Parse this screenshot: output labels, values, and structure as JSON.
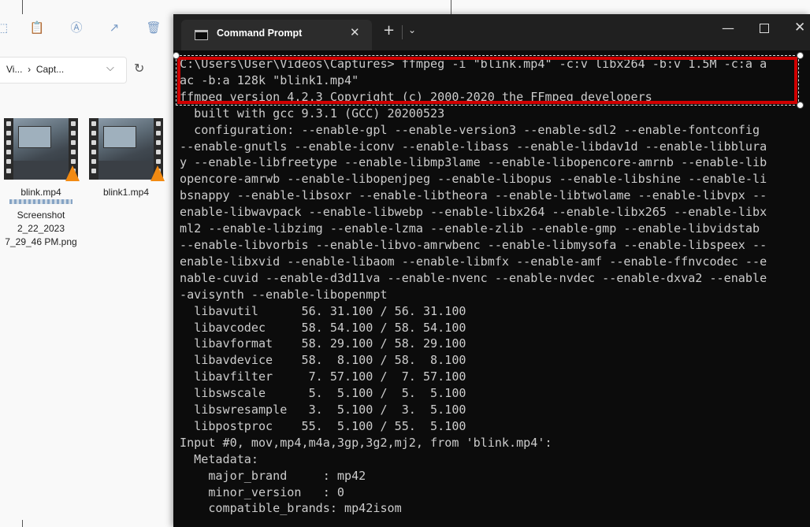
{
  "explorer": {
    "breadcrumb": [
      "Vi...",
      "Capt..."
    ],
    "breadcrumb_sep": "›",
    "toolbar_icons": [
      "copy-icon",
      "paste-icon",
      "rename-icon",
      "share-icon",
      "delete-icon"
    ],
    "files": [
      {
        "name": "blink.mp4",
        "type": "video"
      },
      {
        "name": "blink1.mp4",
        "type": "video"
      },
      {
        "name": "Screenshot 2_22_2023 7_29_46 PM.png",
        "label_lines": [
          "Screenshot",
          "2_22_2023",
          "7_29_46 PM.png"
        ],
        "type": "image"
      }
    ]
  },
  "terminal": {
    "tab_title": "Command Prompt",
    "tab_close": "✕",
    "new_tab": "+",
    "dropdown": "⌄",
    "minimize": "—",
    "close": "✕",
    "lines": [
      "C:\\Users\\User\\Videos\\Captures> ffmpeg -i \"blink.mp4\" -c:v libx264 -b:v 1.5M -c:a a",
      "ac -b:a 128k \"blink1.mp4\"",
      "ffmpeg version 4.2.3 Copyright (c) 2000-2020 the FFmpeg developers",
      "  built with gcc 9.3.1 (GCC) 20200523",
      "  configuration: --enable-gpl --enable-version3 --enable-sdl2 --enable-fontconfig",
      "--enable-gnutls --enable-iconv --enable-libass --enable-libdav1d --enable-libblura",
      "y --enable-libfreetype --enable-libmp3lame --enable-libopencore-amrnb --enable-lib",
      "opencore-amrwb --enable-libopenjpeg --enable-libopus --enable-libshine --enable-li",
      "bsnappy --enable-libsoxr --enable-libtheora --enable-libtwolame --enable-libvpx --",
      "enable-libwavpack --enable-libwebp --enable-libx264 --enable-libx265 --enable-libx",
      "ml2 --enable-libzimg --enable-lzma --enable-zlib --enable-gmp --enable-libvidstab",
      "--enable-libvorbis --enable-libvo-amrwbenc --enable-libmysofa --enable-libspeex --",
      "enable-libxvid --enable-libaom --enable-libmfx --enable-amf --enable-ffnvcodec --e",
      "nable-cuvid --enable-d3d11va --enable-nvenc --enable-nvdec --enable-dxva2 --enable",
      "-avisynth --enable-libopenmpt",
      "  libavutil      56. 31.100 / 56. 31.100",
      "  libavcodec     58. 54.100 / 58. 54.100",
      "  libavformat    58. 29.100 / 58. 29.100",
      "  libavdevice    58.  8.100 / 58.  8.100",
      "  libavfilter     7. 57.100 /  7. 57.100",
      "  libswscale      5.  5.100 /  5.  5.100",
      "  libswresample   3.  5.100 /  3.  5.100",
      "  libpostproc    55.  5.100 / 55.  5.100",
      "Input #0, mov,mp4,m4a,3gp,3g2,mj2, from 'blink.mp4':",
      "  Metadata:",
      "    major_brand     : mp42",
      "    minor_version   : 0",
      "    compatible_brands: mp42isom"
    ]
  },
  "colors": {
    "terminal_bg": "#0c0c0c",
    "terminal_text": "#cccccc",
    "highlight": "#d00000"
  }
}
